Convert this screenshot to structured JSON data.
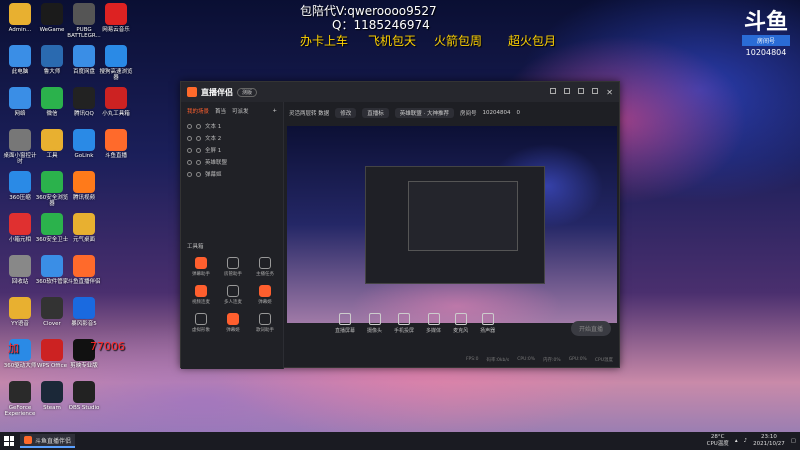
{
  "desktop": {
    "icons": [
      {
        "label": "Admin...",
        "glyph": "folder-icon",
        "color": "#e8b030"
      },
      {
        "label": "WeGame",
        "glyph": "wegame-icon",
        "color": "#1b1b1b"
      },
      {
        "label": "PUBG BATTLEGR...",
        "glyph": "game-icon",
        "color": "#555"
      },
      {
        "label": "网易云音乐",
        "glyph": "music-icon",
        "color": "#d22"
      },
      {
        "label": "此电脑",
        "glyph": "computer-icon",
        "color": "#3a8ee6"
      },
      {
        "label": "鲁大师",
        "glyph": "app-icon",
        "color": "#2a6ab0"
      },
      {
        "label": "百度网盘",
        "glyph": "cloud-icon",
        "color": "#3a8ee6"
      },
      {
        "label": "搜狗高速浏览器",
        "glyph": "browser-icon",
        "color": "#2a8ae6"
      },
      {
        "label": "网络",
        "glyph": "network-icon",
        "color": "#3a8ee6"
      },
      {
        "label": "微信",
        "glyph": "wechat-icon",
        "color": "#2bb24c"
      },
      {
        "label": "腾讯QQ",
        "glyph": "qq-icon",
        "color": "#222"
      },
      {
        "label": "小丸工具箱",
        "glyph": "tool-icon",
        "color": "#c22"
      },
      {
        "label": "桌面小窗控计时",
        "glyph": "timer-icon",
        "color": "#777"
      },
      {
        "label": "工具",
        "glyph": "folder-icon",
        "color": "#e8b030"
      },
      {
        "label": "GoLink",
        "glyph": "golink-icon",
        "color": "#2a8ae6"
      },
      {
        "label": "斗鱼直播",
        "glyph": "douyu-icon",
        "color": "#ff6a2b"
      },
      {
        "label": "360压缩",
        "glyph": "zip-icon",
        "color": "#2a8ae6"
      },
      {
        "label": "360安全浏览器",
        "glyph": "browser-icon",
        "color": "#2bb24c"
      },
      {
        "label": "腾讯视频",
        "glyph": "video-icon",
        "color": "#ff7a1a"
      },
      {
        "label": "小箱元相",
        "glyph": "app-icon",
        "color": "#e03030"
      },
      {
        "label": "360安全卫士",
        "glyph": "shield-icon",
        "color": "#2bb24c"
      },
      {
        "label": "元气桌面",
        "glyph": "desktop-icon",
        "color": "#e8b030"
      },
      {
        "label": "回收站",
        "glyph": "recycle-bin-icon",
        "color": "#888"
      },
      {
        "label": "360软件管家",
        "glyph": "store-icon",
        "color": "#3a8ee6"
      },
      {
        "label": "斗鱼直播伴侣",
        "glyph": "douyu-icon",
        "color": "#ff6a2b"
      },
      {
        "label": "YY语音",
        "glyph": "yy-icon",
        "color": "#e8b030"
      },
      {
        "label": "Clover",
        "glyph": "clover-icon",
        "color": "#333"
      },
      {
        "label": "暴风影音5",
        "glyph": "player-icon",
        "color": "#1a6ae0"
      },
      {
        "label": "360驱动大师",
        "glyph": "driver-icon",
        "color": "#2a8ae6"
      },
      {
        "label": "WPS Office",
        "glyph": "wps-icon",
        "color": "#c22"
      },
      {
        "label": "剪映专业版",
        "glyph": "capcut-icon",
        "color": "#111"
      },
      {
        "label": "GeForce Experience",
        "glyph": "nvidia-icon",
        "color": "#2a2a2a"
      },
      {
        "label": "Steam",
        "glyph": "steam-icon",
        "color": "#1b2838"
      },
      {
        "label": "OBS Studio",
        "glyph": "obs-icon",
        "color": "#222"
      }
    ]
  },
  "overlay": {
    "line1": "包陪代V:qweroooo9527",
    "line2": "Q：1185246974",
    "line3a": "办卡上车",
    "line3b": "飞机包天",
    "line3c": "火箭包周",
    "line3d": "超火包月",
    "left_partial_a": "加",
    "left_partial_b": "77006",
    "brand_big": "斗鱼",
    "brand_tag": "房间号",
    "brand_id": "10204804",
    "colors": {
      "white": "#ffffff",
      "yellow": "#ffd200",
      "red": "#ff2a2a"
    }
  },
  "app": {
    "title": "直播伴侣",
    "version_badge": "测版",
    "tabs": [
      "我的场景",
      "首当",
      "可派发"
    ],
    "add_tab": "+",
    "scenes": [
      "文本 1",
      "文本 2",
      "全屏 1",
      "英雄联盟",
      "弹幕姬"
    ],
    "tools_title": "工具箱",
    "tools": [
      {
        "label": "弹幕助手",
        "hot": true
      },
      {
        "label": "房管助手",
        "hot": false
      },
      {
        "label": "主播任务",
        "hot": false
      },
      {
        "label": "视频连麦",
        "hot": true
      },
      {
        "label": "多人连麦",
        "hot": false
      },
      {
        "label": "弹幕姬",
        "hot": true
      },
      {
        "label": "虚拟形象",
        "hot": false
      },
      {
        "label": "弹幕姬",
        "hot": true
      },
      {
        "label": "歌词助手",
        "hot": false
      }
    ],
    "main_top": {
      "category": "灵活两层转 数据",
      "edit": "修改",
      "chip1": "直播标",
      "tag": "英雄联盟 · 大神推荐",
      "room_label": "房间号",
      "room_id": "10204804",
      "counter": "0"
    },
    "bottom_buttons": [
      "直播屏幕",
      "摄像头",
      "手机投屏",
      "多媒体",
      "麦克风",
      "扬声器"
    ],
    "start_live": "开始直播",
    "status": [
      "FPS:0",
      "码率:0kb/s",
      "CPU:0%",
      "内存:0%",
      "GPU:0%",
      "CPU温度"
    ]
  },
  "taskbar": {
    "task_label": "斗鱼直播伴侣",
    "temp": "28°C",
    "temp_label": "CPU温度",
    "time": "23:10",
    "date": "2021/10/27"
  }
}
